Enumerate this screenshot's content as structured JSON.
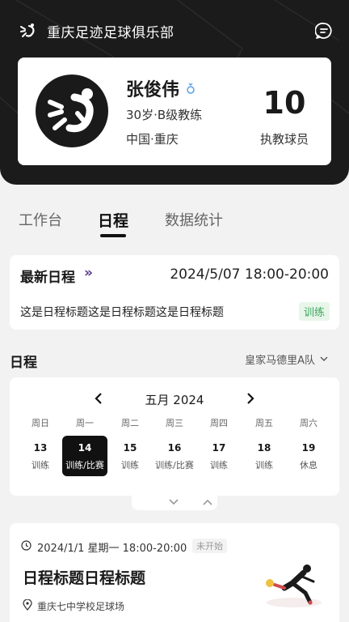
{
  "header": {
    "club_name": "重庆足迹足球俱乐部"
  },
  "profile": {
    "name": "张俊伟",
    "meta": "30岁·B级教练",
    "location": "中国·重庆",
    "player_count": "10",
    "player_count_label": "执教球员"
  },
  "tabs": [
    {
      "label": "工作台",
      "active": false
    },
    {
      "label": "日程",
      "active": true
    },
    {
      "label": "数据统计",
      "active": false
    }
  ],
  "latest": {
    "title": "最新日程",
    "arrow": "»",
    "datetime": "2024/5/07  18:00-20:00",
    "description": "这是日程标题这是日程标题这是日程标题",
    "tag": "训练"
  },
  "schedule": {
    "label": "日程",
    "team": "皇家马德里A队"
  },
  "calendar": {
    "month": "五月 2024",
    "weekdays": [
      "周日",
      "周一",
      "周二",
      "周三",
      "周四",
      "周五",
      "周六"
    ],
    "days": [
      {
        "num": "13",
        "activity": "训练"
      },
      {
        "num": "14",
        "activity": "训练/比赛",
        "selected": true
      },
      {
        "num": "15",
        "activity": "训练"
      },
      {
        "num": "16",
        "activity": "训练/比赛"
      },
      {
        "num": "17",
        "activity": "训练"
      },
      {
        "num": "18",
        "activity": "训练"
      },
      {
        "num": "19",
        "activity": "休息"
      }
    ]
  },
  "event": {
    "time": "2024/1/1  星期一 18:00-20:00",
    "status": "未开始",
    "title": "日程标题日程标题",
    "location": "重庆七中学校足球场"
  },
  "colors": {
    "dark": "#1b1b1b",
    "tag_green": "#3aa55b",
    "accent_purple": "#5a3d8a"
  },
  "icons": [
    "club-logo-icon",
    "chat-icon",
    "male-icon",
    "chevron-left-icon",
    "chevron-right-icon",
    "chevron-down-icon",
    "chevron-up-icon",
    "clock-icon",
    "location-pin-icon"
  ]
}
